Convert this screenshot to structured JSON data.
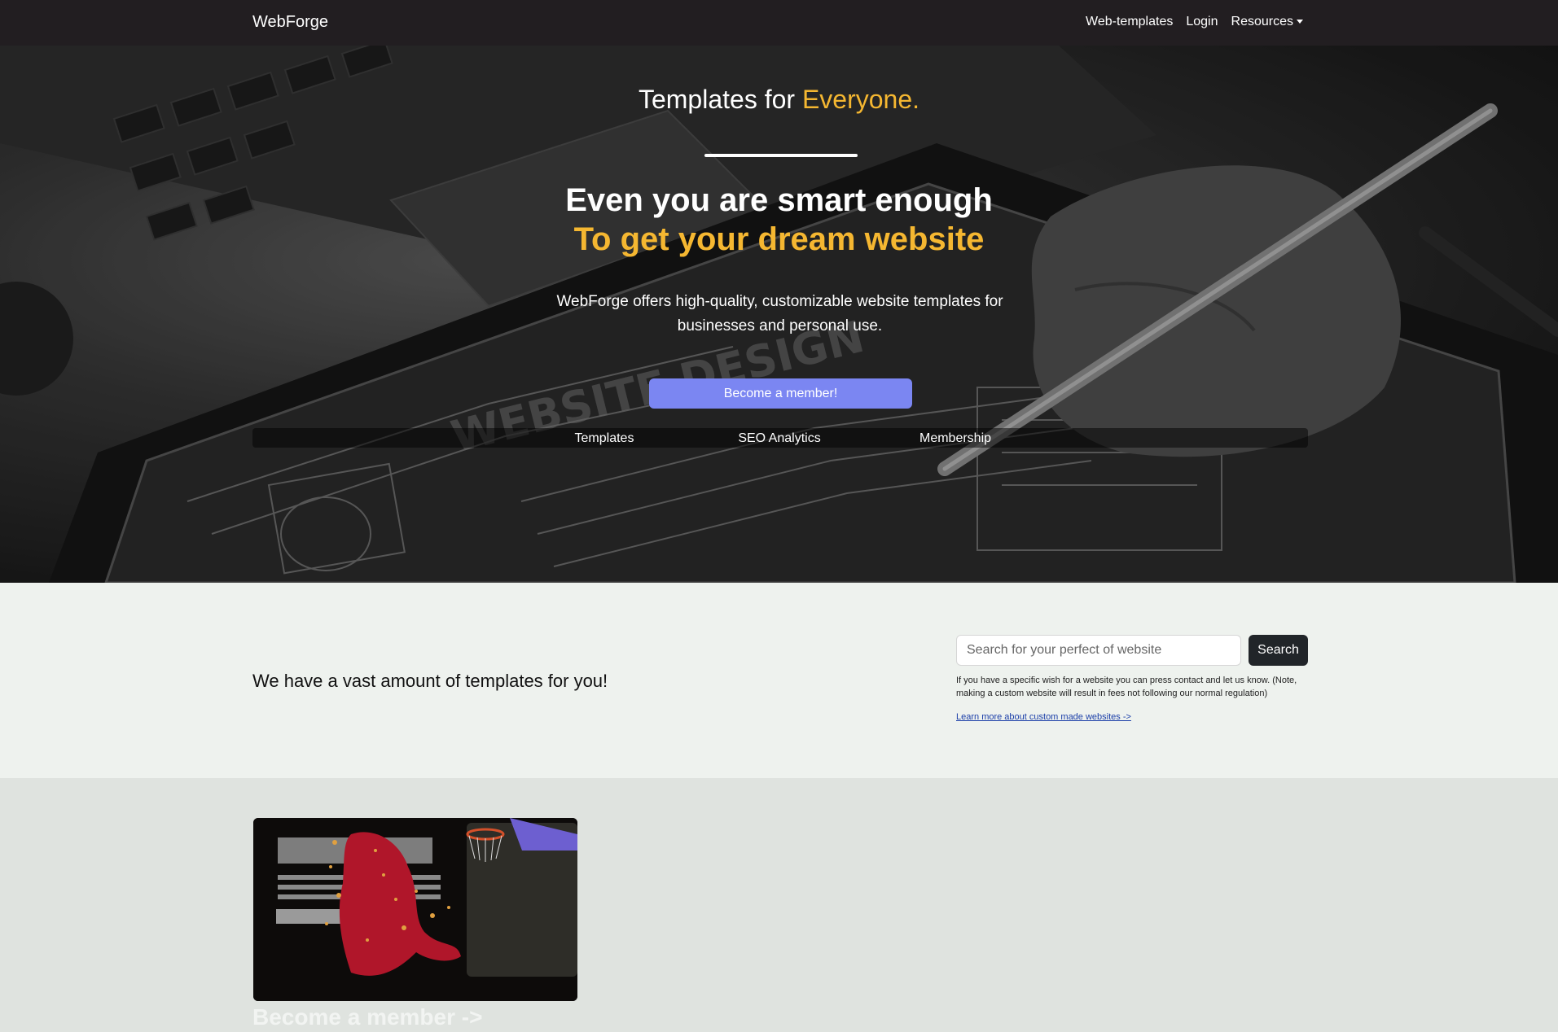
{
  "navbar": {
    "brand": "WebForge",
    "links": [
      {
        "label": "Web-templates"
      },
      {
        "label": "Login"
      },
      {
        "label": "Resources"
      }
    ]
  },
  "hero": {
    "tagline_prefix": "Templates for",
    "tagline_accent": "Everyone.",
    "headline": "Even you are smart enough",
    "subheadline": "To get your dream website",
    "description": "WebForge offers high-quality, customizable website templates for businesses and personal use.",
    "cta_label": "Become a member!",
    "features": [
      {
        "label": "Templates"
      },
      {
        "label": "SEO Analytics"
      },
      {
        "label": "Membership"
      }
    ],
    "colors": {
      "accent": "#f5b731",
      "cta": "#7b86f2"
    }
  },
  "search": {
    "heading": "We have a vast amount of templates for you!",
    "placeholder": "Search for your perfect of website",
    "button_label": "Search",
    "note": "If you have a specific wish for a website you can press contact and let us know. (Note, making a custom website will result in fees not following our normal regulation)",
    "link_label": "Learn more about custom made websites ->"
  },
  "card": {
    "title": "Become a member ->"
  }
}
